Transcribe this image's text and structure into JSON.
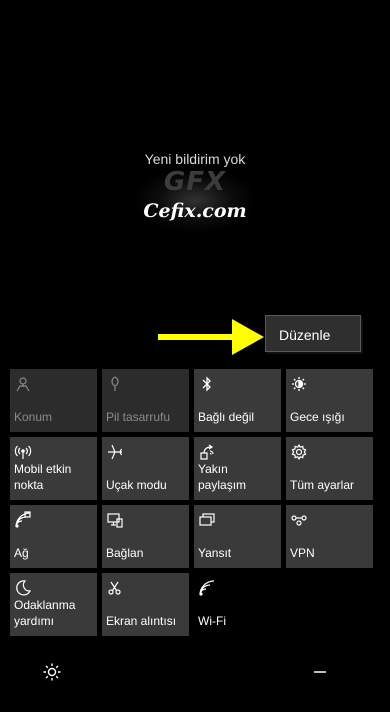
{
  "notifications": {
    "empty_text": "Yeni bildirim yok"
  },
  "watermark": {
    "logo_text": "GFX",
    "brand_text": "Cefix.com"
  },
  "edit_button": {
    "label": "Düzenle"
  },
  "arrow_color": "#ffff00",
  "tiles": [
    {
      "label": "Konum",
      "icon": "location-icon",
      "state": "off"
    },
    {
      "label": "Pil tasarrufu",
      "icon": "battery-saver-icon",
      "state": "off"
    },
    {
      "label": "Bağlı değil",
      "icon": "bluetooth-icon",
      "state": "on"
    },
    {
      "label": "Gece ışığı",
      "icon": "night-light-icon",
      "state": "on"
    },
    {
      "label": "Mobil etkin nokta",
      "icon": "mobile-hotspot-icon",
      "state": "on"
    },
    {
      "label": "Uçak modu",
      "icon": "airplane-icon",
      "state": "on"
    },
    {
      "label": "Yakın paylaşım",
      "icon": "nearby-share-icon",
      "state": "on"
    },
    {
      "label": "Tüm ayarlar",
      "icon": "gear-icon",
      "state": "on"
    },
    {
      "label": "Ağ",
      "icon": "network-icon",
      "state": "on"
    },
    {
      "label": "Bağlan",
      "icon": "connect-icon",
      "state": "on"
    },
    {
      "label": "Yansıt",
      "icon": "project-icon",
      "state": "on"
    },
    {
      "label": "VPN",
      "icon": "vpn-icon",
      "state": "on"
    },
    {
      "label": "Odaklanma yardımı",
      "icon": "focus-assist-icon",
      "state": "on"
    },
    {
      "label": "Ekran alıntısı",
      "icon": "screen-snip-icon",
      "state": "on"
    },
    {
      "label": "Wi-Fi",
      "icon": "wifi-icon",
      "state": "on"
    }
  ],
  "bottom_bar": {
    "brightness_icon": "brightness-icon",
    "collapse_icon": "minus-icon"
  }
}
